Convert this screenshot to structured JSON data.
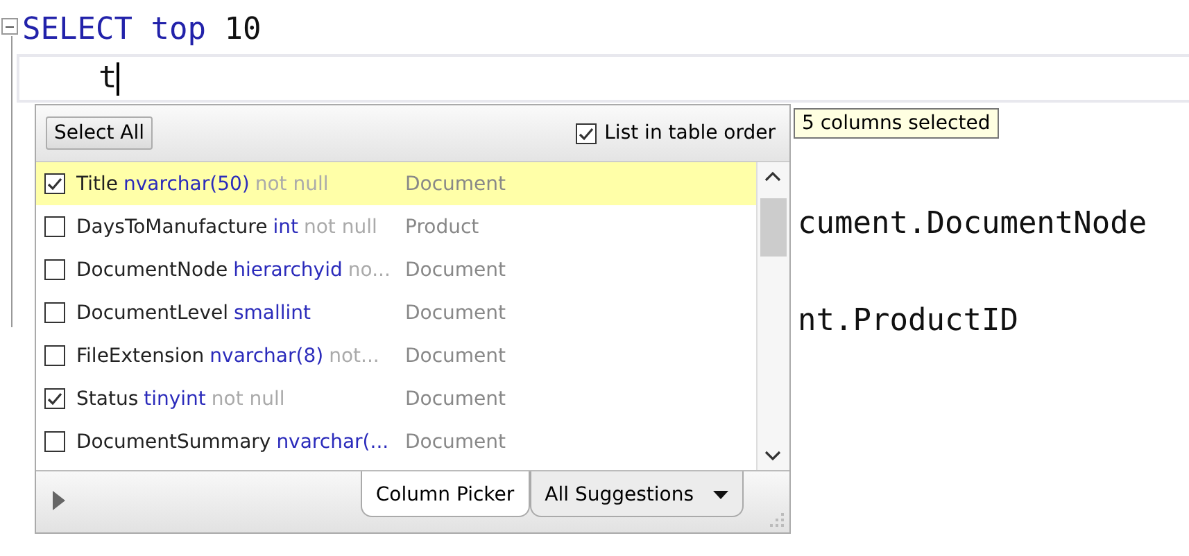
{
  "editor": {
    "lines": [
      {
        "kind": "code",
        "tokens": [
          {
            "text": "SELECT",
            "kind": "keyword"
          },
          {
            "text": " top",
            "kind": "keyword"
          },
          {
            "text": " 10",
            "kind": "plain"
          }
        ]
      },
      {
        "kind": "current",
        "tokens": [
          {
            "text": "    t",
            "kind": "plain"
          }
        ]
      },
      {
        "kind": "blank"
      },
      {
        "kind": "blank"
      },
      {
        "kind": "code",
        "tokens": [
          {
            "text": "cument.DocumentNode",
            "kind": "plain"
          }
        ]
      },
      {
        "kind": "blank"
      },
      {
        "kind": "code",
        "tokens": [
          {
            "text": "nt.ProductID",
            "kind": "plain"
          }
        ]
      }
    ]
  },
  "tooltip": "5 columns selected",
  "picker": {
    "select_all": "Select All",
    "table_order": {
      "label": "List in table order",
      "checked": true
    },
    "columns": [
      {
        "name": "Title",
        "type": "nvarchar(50)",
        "nullability": "not null",
        "table": "Document",
        "checked": true,
        "selected": true
      },
      {
        "name": "DaysToManufacture",
        "type": "int",
        "nullability": "not null",
        "table": "Product",
        "checked": false,
        "selected": false
      },
      {
        "name": "DocumentNode",
        "type": "hierarchyid",
        "nullability": "no...",
        "table": "Document",
        "checked": false,
        "selected": false
      },
      {
        "name": "DocumentLevel",
        "type": "smallint",
        "table": "Document",
        "checked": false,
        "selected": false
      },
      {
        "name": "FileExtension",
        "type": "nvarchar(8)",
        "nullability": "not...",
        "table": "Document",
        "checked": false,
        "selected": false
      },
      {
        "name": "Status",
        "type": "tinyint",
        "nullability": "not null",
        "table": "Document",
        "checked": true,
        "selected": false
      },
      {
        "name": "DocumentSummary",
        "type": "nvarchar(...",
        "table": "Document",
        "checked": false,
        "selected": false
      }
    ],
    "tabs": [
      {
        "label": "Column Picker",
        "selected": true,
        "kind": "plain"
      },
      {
        "label": "All Suggestions",
        "selected": false,
        "kind": "dropdown"
      }
    ]
  }
}
